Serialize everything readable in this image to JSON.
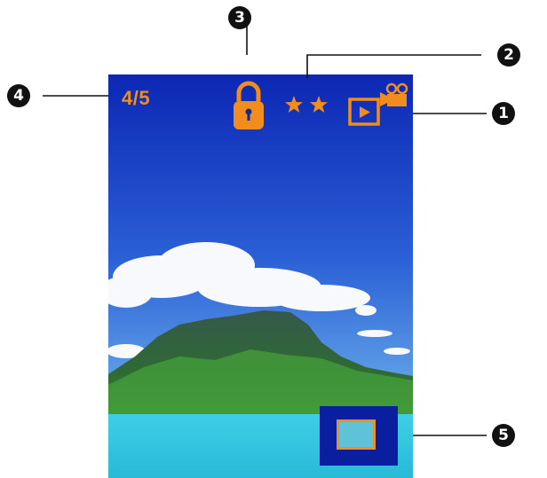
{
  "screen": {
    "image_count": "4/5",
    "rating_stars": 2,
    "icons": [
      "lock-icon",
      "star-icon",
      "video-playback-icon"
    ],
    "colors": {
      "hud_accent": "#f28c1c",
      "sky_top": "#0f2fb8",
      "sky_bottom": "#4f95e2",
      "sea": "#34c3de",
      "thumbnail_bg": "#0a1fa0"
    }
  },
  "callouts": [
    "1",
    "2",
    "3",
    "4",
    "5"
  ]
}
